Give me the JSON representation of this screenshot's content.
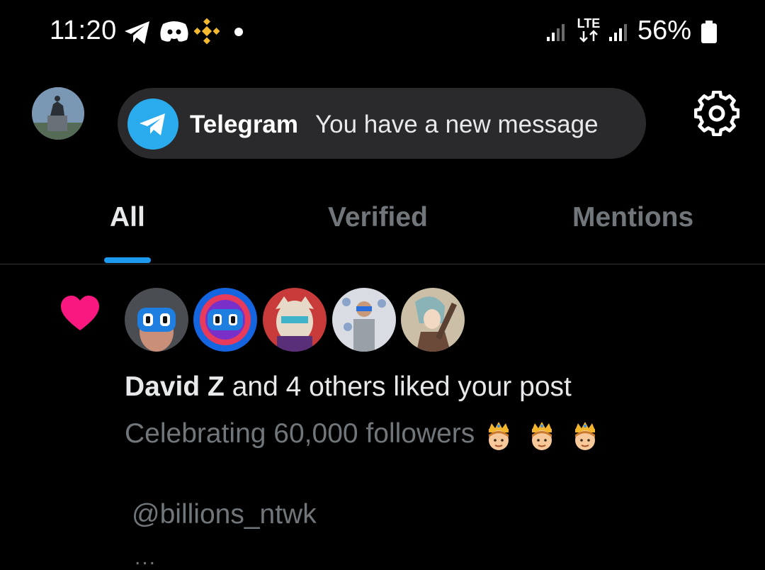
{
  "status_bar": {
    "time": "11:20",
    "battery_percent": "56%",
    "network_label": "LTE",
    "icons": [
      "telegram-icon",
      "discord-icon",
      "binance-icon",
      "notification-dot-icon",
      "signal-icon",
      "lte-icon",
      "signal-icon",
      "battery-icon"
    ]
  },
  "header": {
    "notification_toast": {
      "app": "Telegram",
      "message": "You have a new message"
    }
  },
  "tabs": [
    {
      "label": "All",
      "active": true
    },
    {
      "label": "Verified",
      "active": false
    },
    {
      "label": "Mentions",
      "active": false
    }
  ],
  "notification": {
    "actor": "David Z",
    "action": "and 4 others liked your post",
    "post_text": "Celebrating 60,000 followers",
    "post_emojis": [
      "crown-face-emoji",
      "crown-face-emoji",
      "crown-face-emoji"
    ],
    "mention": "@billions_ntwk",
    "continuation": "..."
  },
  "colors": {
    "background": "#000000",
    "accent": "#1d9bf0",
    "like": "#f91880",
    "telegram": "#2aabee",
    "muted_text": "#71767b",
    "binance": "#f3ba2f"
  }
}
